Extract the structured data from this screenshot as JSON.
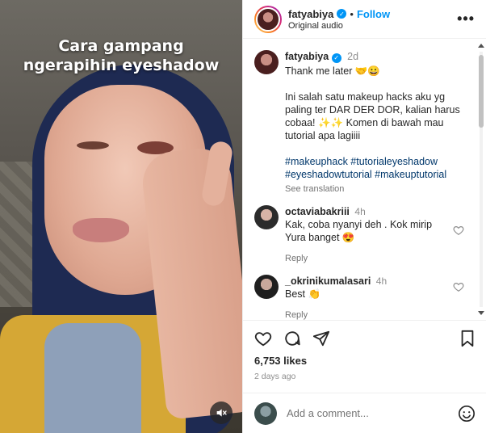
{
  "video": {
    "caption": "Cara gampang\nngerapihin eyeshadow",
    "mute_icon": "speaker-muted-icon"
  },
  "header": {
    "username": "fatyabiya",
    "dot": "•",
    "follow_label": "Follow",
    "audio": "Original audio",
    "more_label": "•••"
  },
  "post": {
    "username": "fatyabiya",
    "time": "2d",
    "caption": "Thank me later 🤝😀\n\nIni salah satu makeup hacks aku yg paling ter DAR DER DOR, kalian harus cobaa! ✨✨ Komen di bawah mau tutorial apa lagiiii",
    "hashtags": "#makeuphack #tutorialeyeshadow #eyeshadowtutorial #makeuptutorial",
    "see_translation": "See translation"
  },
  "comments": [
    {
      "username": "octaviabakriii",
      "time": "4h",
      "text": "Kak, coba nyanyi deh . Kok mirip Yura banget 😍",
      "reply_label": "Reply"
    },
    {
      "username": "_okrinikumalasari",
      "time": "4h",
      "text": "Best 👏",
      "reply_label": "Reply"
    }
  ],
  "actions": {
    "likes": "6,753 likes",
    "ago": "2 days ago"
  },
  "add_comment": {
    "placeholder": "Add a comment..."
  },
  "colors": {
    "accent": "#0095f6",
    "hashtag": "#00376b",
    "muted": "#8e8e8e"
  }
}
